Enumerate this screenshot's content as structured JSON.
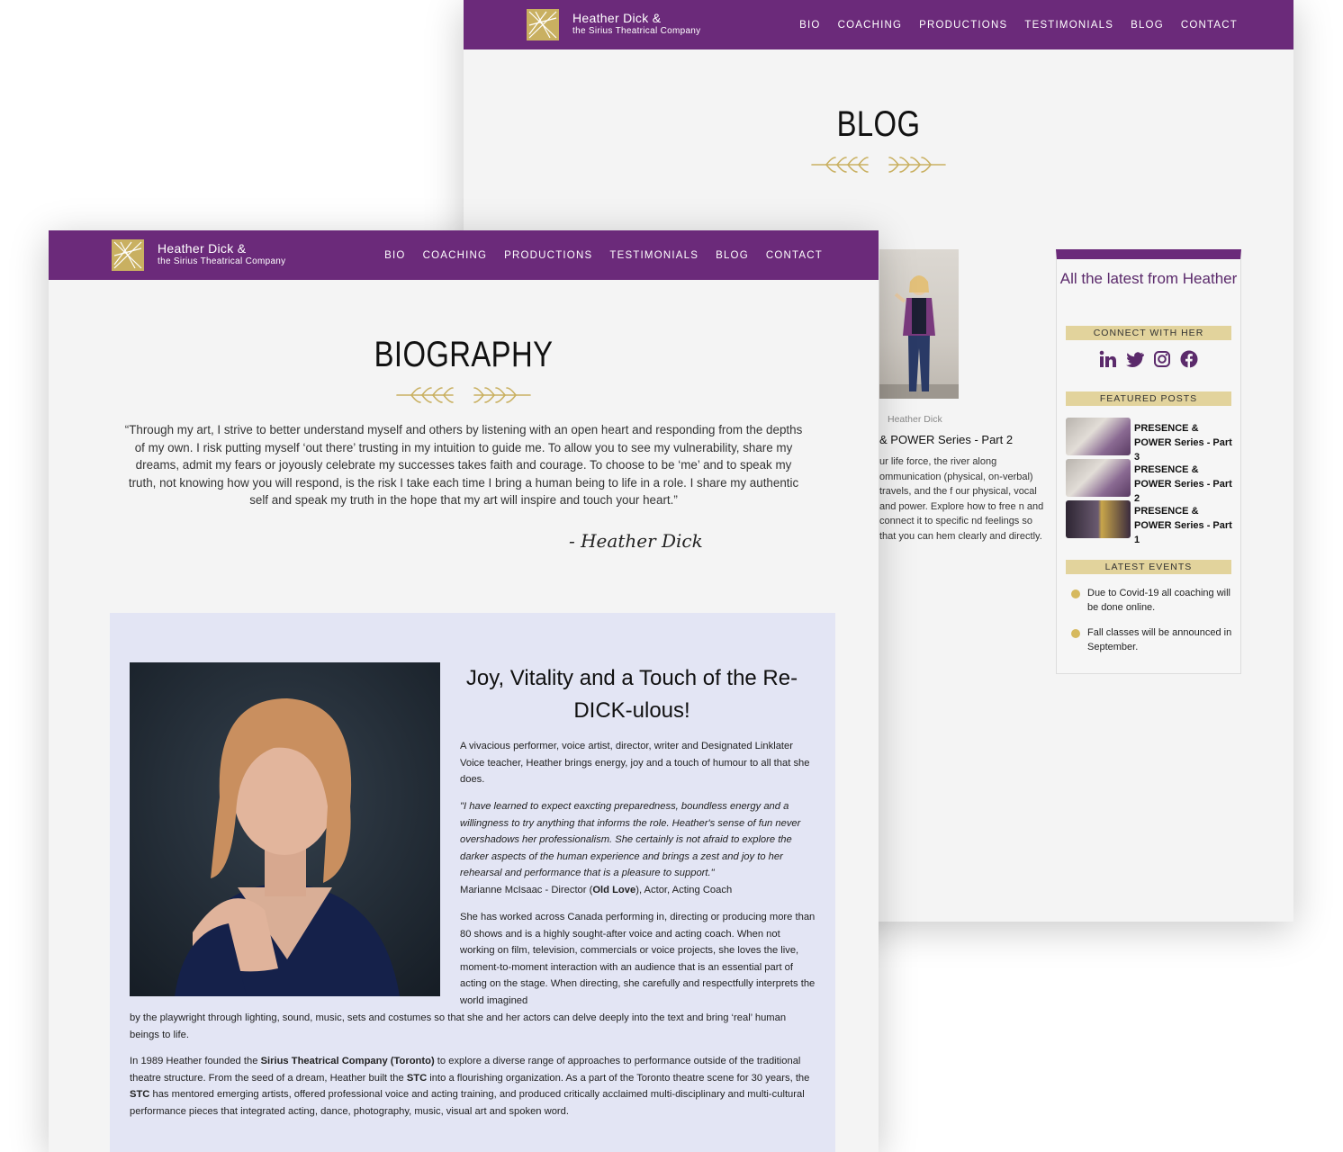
{
  "site": {
    "brand_name": "Heather Dick &",
    "brand_sub": "the Sirius Theatrical Company",
    "nav": [
      "BIO",
      "COACHING",
      "PRODUCTIONS",
      "TESTIMONIALS",
      "BLOG",
      "CONTACT"
    ],
    "accent": "#6b2a7a",
    "gold": "#c9b061"
  },
  "blog": {
    "title": "BLOG",
    "post": {
      "caption": "Heather Dick",
      "title": "& POWER Series - Part 2",
      "excerpt": "ur life force, the river along ommunication (physical, on-verbal) travels, and the f our physical, vocal and power. Explore how to free n and connect it to specific nd feelings so that you can hem clearly and directly."
    },
    "sidebar": {
      "title": "All the latest from Heather",
      "connect_label": "CONNECT WITH HER",
      "social_icons": [
        "linkedin-icon",
        "twitter-icon",
        "instagram-icon",
        "facebook-icon"
      ],
      "featured_label": "FEATURED POSTS",
      "featured": [
        {
          "title": "PRESENCE & POWER Series - Part 3"
        },
        {
          "title": "PRESENCE & POWER Series - Part 2"
        },
        {
          "title": "PRESENCE & POWER Series - Part 1"
        }
      ],
      "events_label": "LATEST EVENTS",
      "events": [
        {
          "text": "Due to Covid-19 all coaching will be done online."
        },
        {
          "text": "Fall classes will be announced in September."
        }
      ]
    }
  },
  "bio": {
    "title": "BIOGRAPHY",
    "quote": "“Through my art, I strive to better understand myself and others by listening with an open heart and responding from the depths of my own. I risk putting myself ‘out there’ trusting in my intuition to guide me. To allow you to see my vulnerability, share my dreams, admit my fears or joyously celebrate my successes takes faith and courage. To choose to be ‘me’ and to speak my truth, not knowing how you will respond, is the risk I take each time I bring a human being to life in a role. I share my authentic self and speak my truth in the hope that my art will inspire and touch your heart.”",
    "signature": "- Heather Dick",
    "heading": "Joy, Vitality and a Touch of the Re-DICK-ulous!",
    "para1": "A vivacious performer, voice artist, director, writer and Designated Linklater Voice teacher, Heather brings energy, joy and a touch of humour to all that she does.",
    "testimonial": "\"I have learned to expect eaxcting preparedness, boundless energy and a willingness to try anything that informs the role. Heather's sense of fun never overshadows her professionalism. She certainly is not afraid to explore the darker aspects of the human experience and brings a zest and joy to her rehearsal and performance that is a pleasure to support.\"",
    "testimonial_author_pre": "Marianne McIsaac - Director (",
    "testimonial_author_bold": "Old Love",
    "testimonial_author_post": "), Actor, Acting Coach",
    "para2a": "She has worked across Canada performing in, directing or producing more than 80 shows and is a highly sought-after voice and acting coach. When not working on film, television, commercials or voice projects, she loves the live, moment-to-moment interaction with an audience that is an essential part of acting on the stage. When directing, she carefully and respectfully interprets the world imagined",
    "para2b": "by the playwright through lighting, sound, music, sets and costumes so that she and her actors can delve deeply into the text and bring ‘real’ human beings to life.",
    "para3_pre": "In 1989 Heather founded the ",
    "para3_b1": "Sirius Theatrical Company (Toronto)",
    "para3_mid1": " to explore a diverse range of approaches to performance outside of the traditional theatre structure. From the seed of a dream, Heather built the ",
    "para3_b2": "STC",
    "para3_mid2": " into a flourishing organization. As a part of the Toronto theatre scene for 30 years, the ",
    "para3_b3": "STC",
    "para3_post": " has mentored emerging artists, offered professional voice and acting training, and produced critically acclaimed multi-disciplinary and multi-cultural performance pieces that integrated acting, dance, photography, music, visual art and spoken word."
  }
}
